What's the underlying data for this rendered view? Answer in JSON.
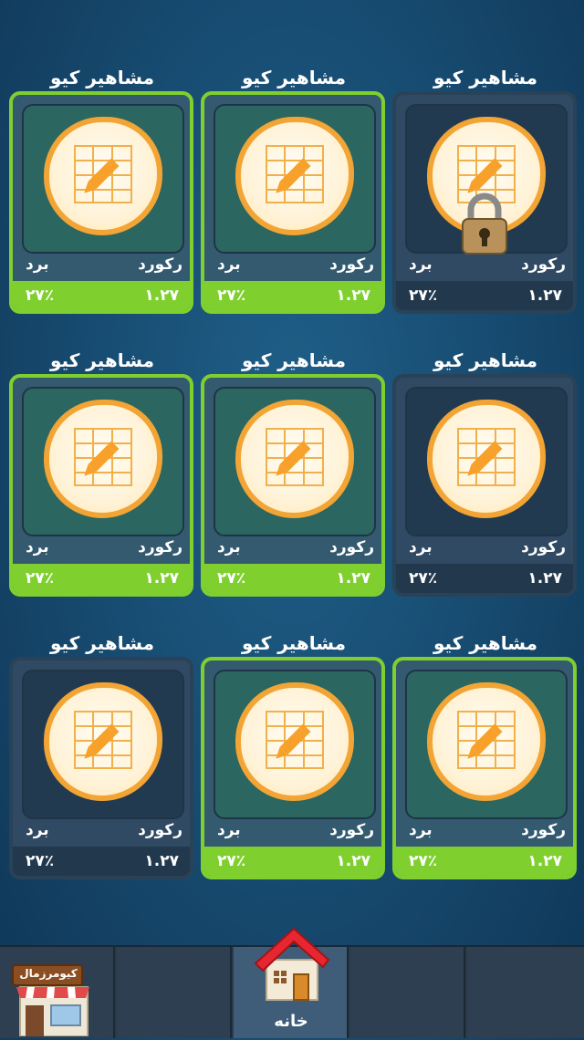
{
  "levels": [
    {
      "title": "مشاهیر کیو",
      "record_label": "رکورد",
      "win_label": "برد",
      "record_value": "۱.۲۷",
      "win_value": "۲۷٪",
      "state": "locked"
    },
    {
      "title": "مشاهیر کیو",
      "record_label": "رکورد",
      "win_label": "برد",
      "record_value": "۱.۲۷",
      "win_value": "۲۷٪",
      "state": "unlocked"
    },
    {
      "title": "مشاهیر کیو",
      "record_label": "رکورد",
      "win_label": "برد",
      "record_value": "۱.۲۷",
      "win_value": "۲۷٪",
      "state": "unlocked"
    },
    {
      "title": "مشاهیر کیو",
      "record_label": "رکورد",
      "win_label": "برد",
      "record_value": "۱.۲۷",
      "win_value": "۲۷٪",
      "state": "dim"
    },
    {
      "title": "مشاهیر کیو",
      "record_label": "رکورد",
      "win_label": "برد",
      "record_value": "۱.۲۷",
      "win_value": "۲۷٪",
      "state": "unlocked"
    },
    {
      "title": "مشاهیر کیو",
      "record_label": "رکورد",
      "win_label": "برد",
      "record_value": "۱.۲۷",
      "win_value": "۲۷٪",
      "state": "unlocked"
    },
    {
      "title": "مشاهیر کیو",
      "record_label": "رکورد",
      "win_label": "برد",
      "record_value": "۱.۲۷",
      "win_value": "۲۷٪",
      "state": "unlocked"
    },
    {
      "title": "مشاهیر کیو",
      "record_label": "رکورد",
      "win_label": "برد",
      "record_value": "۱.۲۷",
      "win_value": "۲۷٪",
      "state": "unlocked"
    },
    {
      "title": "مشاهیر کیو",
      "record_label": "رکورد",
      "win_label": "برد",
      "record_value": "۱.۲۷",
      "win_value": "۲۷٪",
      "state": "dim"
    }
  ],
  "bottom_nav": {
    "shop_sign": "کیومرزمال",
    "home_label": "خانه"
  },
  "colors": {
    "accent_green": "#7fd02f",
    "card_orange": "#f2a435",
    "background": "#184d73"
  },
  "icons": {
    "level_icon": "grid-pencil-icon",
    "lock_icon": "padlock-icon",
    "home_icon": "house-icon",
    "shop_icon": "shop-icon"
  }
}
